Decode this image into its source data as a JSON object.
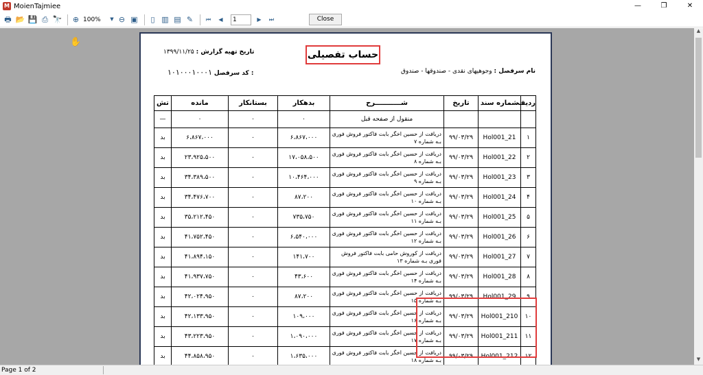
{
  "window": {
    "title": "MoienTajmiee",
    "controls": [
      "—",
      "❐",
      "✕"
    ]
  },
  "toolbar": {
    "zoom": "100%",
    "page_value": "1",
    "close_label": "Close"
  },
  "status": {
    "page_text": "Page 1 of 2"
  },
  "report": {
    "title": "حساب تفصیلی",
    "date_label": "تاریخ تهیه گزارش :",
    "date_value": "۱۳۹۹/۱۱/۲۵",
    "account_label": "نام سرفصل :",
    "account_value": "وجوهپهای نقدی - صندوقها - صندوق",
    "code_label": ": کد سرفصل",
    "code_value": "۱۰۱۰۰۰۱۰۰۰۱",
    "columns": [
      "ردیف",
      "شماره سند",
      "تاریخ",
      "شـــــــــــرح",
      "بدهکار",
      "بستانکار",
      "مانده",
      "تش"
    ],
    "carry": {
      "desc": "منقول از صفحه قبل",
      "debit": "۰",
      "credit": "۰",
      "balance": "۰",
      "type": "—"
    },
    "rows": [
      {
        "n": "۱",
        "doc": "Hol001_21",
        "date": "۹۹/۰۳/۲۹",
        "desc": "دریافت از حسین اخگر بابت فاکتور فروش فوری بـه شماره ۷",
        "debit": "۶،۸۶۷،۰۰۰",
        "credit": "۰",
        "balance": "۶،۸۶۷،۰۰۰",
        "type": "بد"
      },
      {
        "n": "۲",
        "doc": "Hol001_22",
        "date": "۹۹/۰۳/۲۹",
        "desc": "دریافت از حسین اخگر بابت فاکتور فروش فوری بـه شماره ۸",
        "debit": "۱۷،۰۵۸،۵۰۰",
        "credit": "۰",
        "balance": "۲۳،۹۲۵،۵۰۰",
        "type": "بد"
      },
      {
        "n": "۳",
        "doc": "Hol001_23",
        "date": "۹۹/۰۳/۲۹",
        "desc": "دریافت از حسین اخگر بابت فاکتور فروش فوری بـه شماره ۹",
        "debit": "۱۰،۴۶۴،۰۰۰",
        "credit": "۰",
        "balance": "۳۴،۳۸۹،۵۰۰",
        "type": "بد"
      },
      {
        "n": "۴",
        "doc": "Hol001_24",
        "date": "۹۹/۰۳/۲۹",
        "desc": "دریافت از حسین اخگر بابت فاکتور فروش فوری بـه شماره ۱۰",
        "debit": "۸۷،۲۰۰",
        "credit": "۰",
        "balance": "۳۴،۴۷۶،۷۰۰",
        "type": "بد"
      },
      {
        "n": "۵",
        "doc": "Hol001_25",
        "date": "۹۹/۰۳/۲۹",
        "desc": "دریافت از حسین اخگر بابت فاکتور فروش فوری بـه شماره ۱۱",
        "debit": "۷۳۵،۷۵۰",
        "credit": "۰",
        "balance": "۳۵،۲۱۲،۴۵۰",
        "type": "بد"
      },
      {
        "n": "۶",
        "doc": "Hol001_26",
        "date": "۹۹/۰۳/۲۹",
        "desc": "دریافت از حسین اخگر بابت فاکتور فروش فوری بـه شماره ۱۲",
        "debit": "۶،۵۴۰،۰۰۰",
        "credit": "۰",
        "balance": "۴۱،۷۵۲،۴۵۰",
        "type": "بد"
      },
      {
        "n": "۷",
        "doc": "Hol001_27",
        "date": "۹۹/۰۳/۲۹",
        "desc": "دریافت از کوروش حامی بابت فاکتور فروش فوری بـه شماره ۱۳",
        "debit": "۱۴۱،۷۰۰",
        "credit": "۰",
        "balance": "۴۱،۸۹۴،۱۵۰",
        "type": "بد"
      },
      {
        "n": "۸",
        "doc": "Hol001_28",
        "date": "۹۹/۰۳/۲۹",
        "desc": "دریافت از حسین اخگر بابت فاکتور فروش فوری بـه شماره ۱۴",
        "debit": "۴۳،۶۰۰",
        "credit": "۰",
        "balance": "۴۱،۹۳۷،۷۵۰",
        "type": "بد"
      },
      {
        "n": "۹",
        "doc": "Hol001_29",
        "date": "۹۹/۰۳/۲۹",
        "desc": "دریافت از حسین اخگر بابت فاکتور فروش فوری بـه شماره ۱۵",
        "debit": "۸۷،۲۰۰",
        "credit": "۰",
        "balance": "۴۲،۰۲۴،۹۵۰",
        "type": "بد"
      },
      {
        "n": "۱۰",
        "doc": "Hol001_210",
        "date": "۹۹/۰۳/۲۹",
        "desc": "دریافت از حسین اخگر بابت فاکتور فروش فوری بـه شماره ۱۶",
        "debit": "۱۰۹،۰۰۰",
        "credit": "۰",
        "balance": "۴۲،۱۳۳،۹۵۰",
        "type": "بد"
      },
      {
        "n": "۱۱",
        "doc": "Hol001_211",
        "date": "۹۹/۰۳/۲۹",
        "desc": "دریافت از حسین اخگر بابت فاکتور فروش فوری بـه شماره ۱۷",
        "debit": "۱،۰۹۰،۰۰۰",
        "credit": "۰",
        "balance": "۴۳،۲۲۳،۹۵۰",
        "type": "بد"
      },
      {
        "n": "۱۲",
        "doc": "Hol001_212",
        "date": "۹۹/۰۳/۲۹",
        "desc": "دریافت از حسین اخگر بابت فاکتور فروش فوری بـه شماره ۱۸",
        "debit": "۱،۶۳۵،۰۰۰",
        "credit": "۰",
        "balance": "۴۴،۸۵۸،۹۵۰",
        "type": "بد"
      }
    ]
  },
  "colors": {
    "highlight": "#e03a3a",
    "page_border": "#2a3756",
    "viewport_bg": "#a7a7a7"
  }
}
